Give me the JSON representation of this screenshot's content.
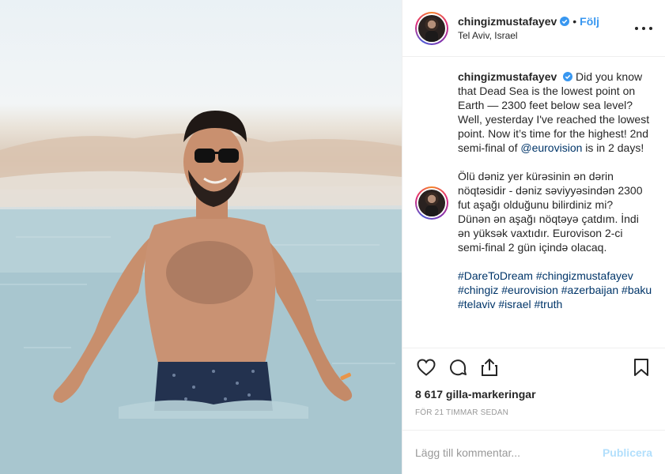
{
  "post": {
    "username": "chingizmustafayev",
    "follow_label": "Följ",
    "location": "Tel Aviv, Israel",
    "separator": "•"
  },
  "caption": {
    "username": "chingizmustafayev",
    "para1_text": "Did you know that Dead Sea is the lowest point on Earth — 2300 feet below sea level? Well, yesterday I've reached the lowest point. Now it’s time for the highest! 2nd semi-final of ",
    "para1_mention": "@eurovision",
    "para1_tail": " is in 2 days!",
    "para2": "Ölü dəniz yer kürəsinin ən dərin nöqtəsidir - dəniz səviyyəsindən 2300 fut aşağı olduğunu bilirdiniz mi?",
    "para3": "Dünən ən aşağı nöqtəyə çatdım. İndi ən yüksək vaxtıdır. Eurovison 2-ci semi-final 2 gün içində olacaq.",
    "hashtags": [
      "#DareToDream",
      "#chingizmustafayev",
      "#chingiz",
      "#eurovision",
      "#azerbaijan",
      "#baku",
      "#telaviv",
      "#israel",
      "#truth"
    ]
  },
  "stats": {
    "likes": "8 617 gilla-markeringar",
    "time": "FÖR 21 TIMMAR SEDAN"
  },
  "comment_box": {
    "placeholder": "Lägg till kommentar...",
    "publish_label": "Publicera"
  },
  "icons": {
    "like": "heart-icon",
    "comment": "comment-icon",
    "share": "share-icon",
    "save": "bookmark-icon",
    "more": "more-icon",
    "verified": "verified-badge-icon"
  },
  "colors": {
    "link": "#3897f0",
    "mention": "#003569",
    "publish_disabled": "#b2dffc",
    "verified": "#3897f0"
  }
}
